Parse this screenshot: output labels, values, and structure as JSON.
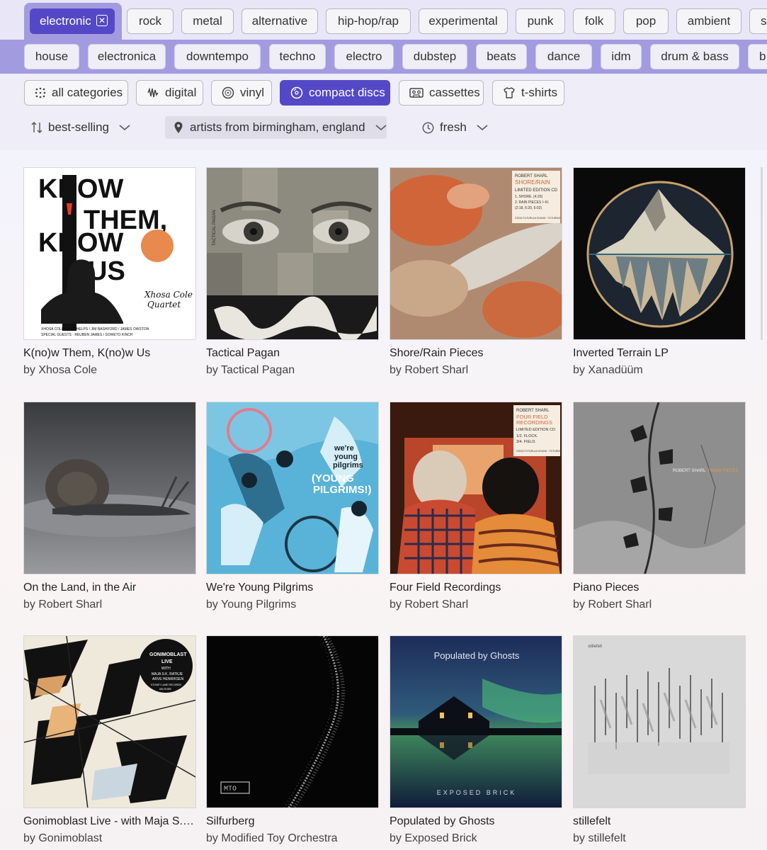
{
  "genres": {
    "selected": "electronic",
    "primary": [
      "rock",
      "metal",
      "alternative",
      "hip-hop/rap",
      "experimental",
      "punk",
      "folk",
      "pop",
      "ambient",
      "s"
    ],
    "sub": [
      "house",
      "electronica",
      "downtempo",
      "techno",
      "electro",
      "dubstep",
      "beats",
      "dance",
      "idm",
      "drum & bass",
      "b"
    ]
  },
  "formats": {
    "items": [
      "all categories",
      "digital",
      "vinyl",
      "compact discs",
      "cassettes",
      "t-shirts"
    ],
    "active": "compact discs"
  },
  "filters": {
    "sort": "best-selling",
    "location": "artists from birmingham, england",
    "time": "fresh"
  },
  "albums": [
    {
      "title": "K(no)w Them, K(no)w Us",
      "artist": "by Xhosa Cole",
      "cover_text": [
        "KNOW",
        "THEM,",
        "KNOW",
        "US",
        "Xhosa Cole",
        "Quartet",
        "XHOSA COLE / JAY PHELPS / JIM BASHFORD / JAMES OWSTON",
        "SPECIAL GUESTS · REUBEN JAMES / SOWETO KINCH"
      ]
    },
    {
      "title": "Tactical Pagan",
      "artist": "by Tactical Pagan",
      "cover_text": [
        "TACTICAL PAGAN"
      ]
    },
    {
      "title": "Shore/Rain Pieces",
      "artist": "by Robert Sharl",
      "cover_text": [
        "ROBERT SHARL",
        "SHORE/RAIN",
        "LIMITED EDITION CD",
        "1. SHORE. (4:20)",
        "2. RAIN PIECES I–III.",
        "(2:18, 6:20, 6:02)",
        "©2024 FUTURULA SOUND · FUTUR002"
      ]
    },
    {
      "title": "Inverted Terrain LP",
      "artist": "by Xanadüüm",
      "cover_text": []
    },
    {
      "title": "On the Land, in the Air",
      "artist": "by Robert Sharl",
      "cover_text": []
    },
    {
      "title": "We're Young Pilgrims",
      "artist": "by Young Pilgrims",
      "cover_text": [
        "we're",
        "young",
        "pilgrims",
        "(YOUNG",
        "PILGRIMS!)"
      ]
    },
    {
      "title": "Four Field Recordings",
      "artist": "by Robert Sharl",
      "cover_text": [
        "ROBERT SHARL",
        "FOUR FIELD",
        "RECORDINGS",
        "LIMITED EDITION CD",
        "1/2. FLOCK.",
        "3/4. FIELD.",
        "©2024 FUTURULA SOUND · FUTUR004"
      ]
    },
    {
      "title": "Piano Pieces",
      "artist": "by Robert Sharl",
      "cover_text": [
        "ROBERT SHARL",
        "PIANO PIECES"
      ]
    },
    {
      "title": "Gonimoblast Live - with Maja S.K. Ratkje, Arve Henriksen",
      "artist": "by Gonimoblast",
      "cover_text": [
        "GONIMOBLAST",
        "LIVE",
        "WITH",
        "MAJA S.K. RATKJE",
        "ARVE HENRIKSEN",
        "STONEY LANE RECORDS",
        "#SLR1955"
      ]
    },
    {
      "title": "Silfurberg",
      "artist": "by Modified Toy Orchestra",
      "cover_text": [
        "MTO"
      ]
    },
    {
      "title": "Populated by Ghosts",
      "artist": "by Exposed Brick",
      "cover_text": [
        "Populated by Ghosts",
        "EXPOSED BRICK"
      ]
    },
    {
      "title": "stillefelt",
      "artist": "by stillefelt",
      "cover_text": [
        "stillefelt"
      ]
    }
  ],
  "colors": {
    "accent": "#5548c7",
    "subrow": "#a39be0"
  }
}
